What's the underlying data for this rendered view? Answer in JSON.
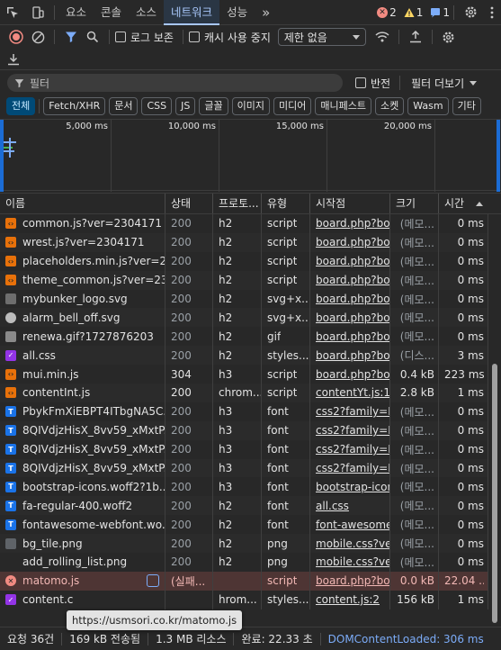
{
  "tabbar": {
    "tabs": [
      "요소",
      "콘솔",
      "소스",
      "네트워크",
      "성능"
    ],
    "active_tab": "네트워크",
    "more": "»",
    "errors": "2",
    "warnings": "1",
    "infos": "1"
  },
  "toolbar": {
    "preserve_log": "로그 보존",
    "disable_cache": "캐시 사용 중지",
    "throttle": "제한 없음"
  },
  "filter": {
    "placeholder": "필터",
    "invert": "반전",
    "more_filters": "필터 더보기"
  },
  "chips": [
    "전체",
    "Fetch/XHR",
    "문서",
    "CSS",
    "JS",
    "글꼴",
    "이미지",
    "미디어",
    "매니페스트",
    "소켓",
    "Wasm",
    "기타"
  ],
  "overview": {
    "ticks": [
      "5,000 ms",
      "10,000 ms",
      "15,000 ms",
      "20,000 ms"
    ]
  },
  "columns": {
    "name": "이름",
    "status": "상태",
    "protocol": "프로토...",
    "type": "유형",
    "initiator": "시작점",
    "size": "크기",
    "time": "시간"
  },
  "rows": [
    {
      "name": "common.js?ver=2304171",
      "status": "200",
      "protocol": "h2",
      "type": "script",
      "initiator": "board.php?bo_t",
      "size": "(메모...",
      "time": "0 ms",
      "icon": "js"
    },
    {
      "name": "wrest.js?ver=2304171",
      "status": "200",
      "protocol": "h2",
      "type": "script",
      "initiator": "board.php?bo_t",
      "size": "(메모...",
      "time": "0 ms",
      "icon": "js"
    },
    {
      "name": "placeholders.min.js?ver=2...",
      "status": "200",
      "protocol": "h2",
      "type": "script",
      "initiator": "board.php?bo_t",
      "size": "(메모...",
      "time": "0 ms",
      "icon": "js"
    },
    {
      "name": "theme_common.js?ver=23...",
      "status": "200",
      "protocol": "h2",
      "type": "script",
      "initiator": "board.php?bo_t",
      "size": "(메모...",
      "time": "0 ms",
      "icon": "js"
    },
    {
      "name": "mybunker_logo.svg",
      "status": "200",
      "protocol": "h2",
      "type": "svg+x...",
      "initiator": "board.php?bo_t",
      "size": "(메모...",
      "time": "0 ms",
      "icon": "svg"
    },
    {
      "name": "alarm_bell_off.svg",
      "status": "200",
      "protocol": "h2",
      "type": "svg+x...",
      "initiator": "board.php?bo_t",
      "size": "(메모...",
      "time": "0 ms",
      "icon": "round"
    },
    {
      "name": "renewa.gif?1727876203",
      "status": "200",
      "protocol": "h2",
      "type": "gif",
      "initiator": "board.php?bo_t",
      "size": "(메모...",
      "time": "0 ms",
      "icon": "gif"
    },
    {
      "name": "all.css",
      "status": "200",
      "protocol": "h2",
      "type": "styles...",
      "initiator": "board.php?bo_t",
      "size": "(디스...",
      "time": "3 ms",
      "icon": "css"
    },
    {
      "name": "mui.min.js",
      "status": "304",
      "protocol": "h3",
      "type": "script",
      "initiator": "board.php?bo_t",
      "size": "0.4 kB",
      "time": "223 ms",
      "icon": "js"
    },
    {
      "name": "contentInt.js",
      "status": "200",
      "protocol": "chrom...",
      "type": "script",
      "initiator": "contentYt.js:1",
      "size": "2.8 kB",
      "time": "1 ms",
      "icon": "js"
    },
    {
      "name": "PbykFmXiEBPT4ITbgNA5C...",
      "status": "200",
      "protocol": "h3",
      "type": "font",
      "initiator": "css2?family=No",
      "size": "(메모...",
      "time": "0 ms",
      "icon": "font"
    },
    {
      "name": "8QIVdjzHisX_8vv59_xMxtP...",
      "status": "200",
      "protocol": "h3",
      "type": "font",
      "initiator": "css2?family=Na",
      "size": "(메모...",
      "time": "0 ms",
      "icon": "font"
    },
    {
      "name": "8QIVdjzHisX_8vv59_xMxtP...",
      "status": "200",
      "protocol": "h3",
      "type": "font",
      "initiator": "css2?family=Na",
      "size": "(메모...",
      "time": "0 ms",
      "icon": "font"
    },
    {
      "name": "8QIVdjzHisX_8vv59_xMxtP...",
      "status": "200",
      "protocol": "h3",
      "type": "font",
      "initiator": "css2?family=Na",
      "size": "(메모...",
      "time": "0 ms",
      "icon": "font"
    },
    {
      "name": "bootstrap-icons.woff2?1b...",
      "status": "200",
      "protocol": "h3",
      "type": "font",
      "initiator": "bootstrap-icons",
      "size": "(메모...",
      "time": "0 ms",
      "icon": "font"
    },
    {
      "name": "fa-regular-400.woff2",
      "status": "200",
      "protocol": "h2",
      "type": "font",
      "initiator": "all.css",
      "size": "(메모...",
      "time": "0 ms",
      "icon": "font"
    },
    {
      "name": "fontawesome-webfont.wo...",
      "status": "200",
      "protocol": "h2",
      "type": "font",
      "initiator": "font-awesome.m",
      "size": "(메모...",
      "time": "0 ms",
      "icon": "font"
    },
    {
      "name": "bg_tile.png",
      "status": "200",
      "protocol": "h2",
      "type": "png",
      "initiator": "mobile.css?ver=",
      "size": "(메모...",
      "time": "0 ms",
      "icon": "img"
    },
    {
      "name": "add_rolling_list.png",
      "status": "200",
      "protocol": "h2",
      "type": "png",
      "initiator": "mobile.css?ver=",
      "size": "(메모...",
      "time": "0 ms",
      "icon": "none"
    },
    {
      "name": "matomo.js",
      "status": "(실패...",
      "protocol": "",
      "type": "script",
      "initiator": "board.php?bo_t",
      "size": "0.0 kB",
      "time": "22.04 ...",
      "icon": "err",
      "error": true
    },
    {
      "name": "content.c",
      "status": "",
      "protocol": "hrom...",
      "type": "styles...",
      "initiator": "content.js:2",
      "size": "156 kB",
      "time": "1 ms",
      "icon": "css"
    }
  ],
  "tooltip": "https://usmsori.co.kr/matomo.js",
  "statusbar": {
    "requests": "요청 36건",
    "transferred": "169 kB 전송됨",
    "resources": "1.3 MB 리소스",
    "finish": "완료: 22.33 초",
    "dcl": "DOMContentLoaded: 306 ms"
  },
  "colors": {
    "background": "#282828",
    "accent": "#a8c7fa",
    "error_row": "#4e3534",
    "error_badge": "#f28b82",
    "warning_badge": "#fdd663",
    "info_badge": "#7cacf8"
  }
}
